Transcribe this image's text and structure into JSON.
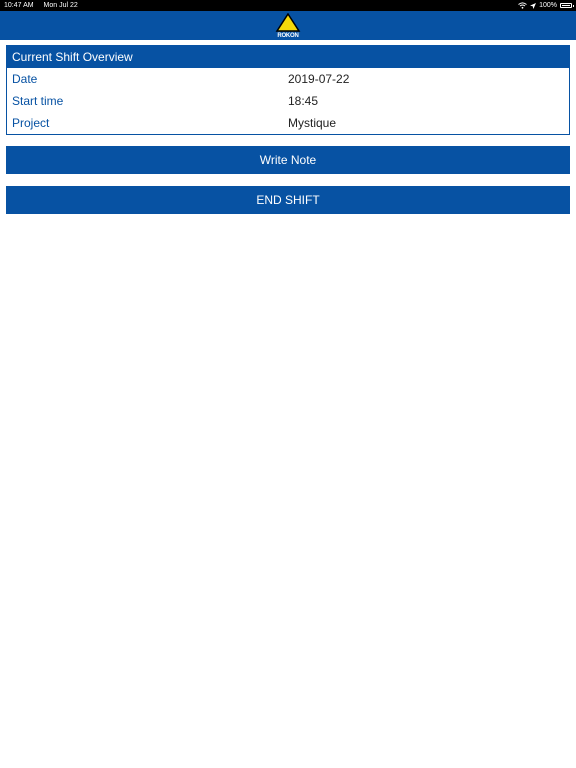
{
  "status_bar": {
    "time": "10:47 AM",
    "date": "Mon Jul 22",
    "battery": "100%"
  },
  "nav": {
    "logo_text": "ROKON",
    "logo_colors": {
      "triangle": "#f5d90a",
      "triangle_outline": "#000000"
    }
  },
  "overview": {
    "title": "Current Shift Overview",
    "rows": [
      {
        "label": "Date",
        "value": "2019-07-22"
      },
      {
        "label": "Start time",
        "value": "18:45"
      },
      {
        "label": "Project",
        "value": "Mystique"
      }
    ]
  },
  "actions": {
    "write_note": "Write Note",
    "end_shift": "END SHIFT"
  },
  "colors": {
    "primary": "#0752a3",
    "background": "#ffffff"
  }
}
